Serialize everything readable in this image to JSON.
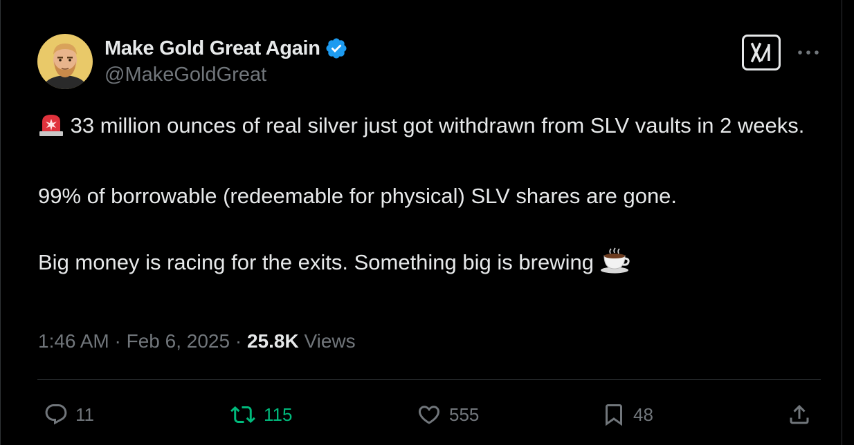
{
  "author": {
    "display_name": "Make Gold Great Again",
    "handle": "@MakeGoldGreat",
    "verified": true,
    "verified_color": "#1d9bf0",
    "avatar_icon": "bearded-man-avatar"
  },
  "header_icons": {
    "grok": "grok-icon",
    "more": "more-icon"
  },
  "tweet": {
    "line1_emoji": "police-siren-emoji",
    "line1": "33 million ounces of real silver just got withdrawn from SLV vaults in 2 weeks.",
    "line2": "99% of borrowable (redeemable for physical) SLV shares are gone.",
    "line3": "Big money is racing for the exits. Something big is brewing",
    "line3_emoji": "hot-beverage-emoji"
  },
  "meta": {
    "time": "1:46 AM",
    "separator": "·",
    "date": "Feb 6, 2025",
    "views_count": "25.8K",
    "views_label": "Views"
  },
  "actions": {
    "replies": "11",
    "reposts": "115",
    "likes": "555",
    "bookmarks": "48"
  },
  "colors": {
    "background": "#000000",
    "text_primary": "#e7e9ea",
    "text_secondary": "#71767b",
    "repost_active": "#00ba7c",
    "border": "#2f3336"
  }
}
